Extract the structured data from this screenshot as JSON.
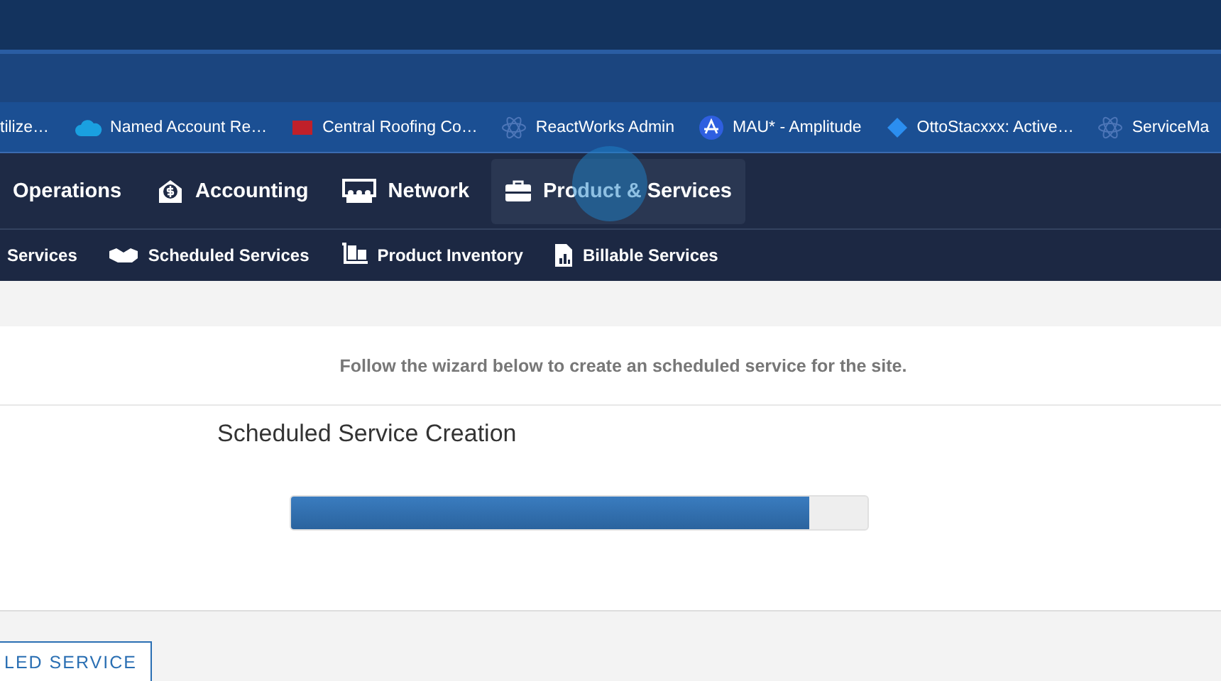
{
  "bookmarks": [
    {
      "label": "tilize…",
      "kind": "none"
    },
    {
      "label": "Named Account Re…",
      "kind": "cloud"
    },
    {
      "label": "Central Roofing Co…",
      "kind": "flag"
    },
    {
      "label": "ReactWorks Admin",
      "kind": "atom"
    },
    {
      "label": "MAU* - Amplitude",
      "kind": "letter"
    },
    {
      "label": "OttoStacxxx: Active…",
      "kind": "diamond"
    },
    {
      "label": "ServiceMa",
      "kind": "atom"
    }
  ],
  "nav": [
    {
      "label": "Operations",
      "kind": "none",
      "selected": false
    },
    {
      "label": "Accounting",
      "kind": "money",
      "selected": false
    },
    {
      "label": "Network",
      "kind": "network",
      "selected": false
    },
    {
      "label": "Product & Services",
      "kind": "briefcase",
      "selected": true
    }
  ],
  "subnav": [
    {
      "label": "Services",
      "kind": "none"
    },
    {
      "label": "Scheduled Services",
      "kind": "handshake"
    },
    {
      "label": "Product Inventory",
      "kind": "cart"
    },
    {
      "label": "Billable Services",
      "kind": "report"
    }
  ],
  "message": "Follow the wizard below to create an scheduled service for the site.",
  "wizard": {
    "title": "Scheduled Service Creation",
    "level": 0.9
  },
  "action_button": "LED SERVICE"
}
